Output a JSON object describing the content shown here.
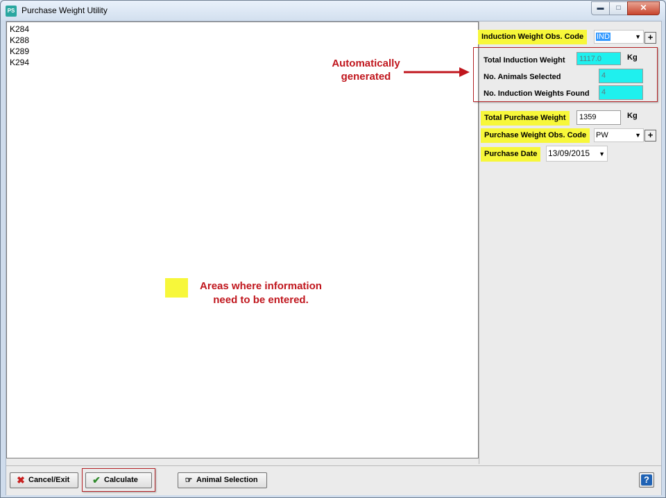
{
  "window": {
    "title": "Purchase Weight Utility",
    "icon_text": "PS"
  },
  "list": {
    "items": [
      "K284",
      "K288",
      "K289",
      "K294"
    ]
  },
  "form": {
    "induction_obs_code": {
      "label": "Induction Weight Obs. Code",
      "value": "IND"
    },
    "total_induction_weight": {
      "label": "Total Induction Weight",
      "value": "1117.0",
      "unit": "Kg"
    },
    "animals_selected": {
      "label": "No. Animals Selected",
      "value": "4"
    },
    "induction_weights_found": {
      "label": "No. Induction Weights Found",
      "value": "4"
    },
    "total_purchase_weight": {
      "label": "Total Purchase Weight",
      "value": "1359",
      "unit": "Kg"
    },
    "purchase_obs_code": {
      "label": "Purchase Weight Obs. Code",
      "value": "PW"
    },
    "purchase_date": {
      "label": "Purchase Date",
      "value": "13/09/2015"
    }
  },
  "annotations": {
    "auto_line1": "Automatically",
    "auto_line2": "generated",
    "legend_line1": "Areas where information",
    "legend_line2": "need to be entered.",
    "highlight_color": "#f7f73a",
    "annotation_color": "#c0161d"
  },
  "buttons": {
    "cancel_label": "Cancel/Exit",
    "calculate_label": "Calculate",
    "animal_selection_label": "Animal Selection",
    "help_label": "?"
  }
}
